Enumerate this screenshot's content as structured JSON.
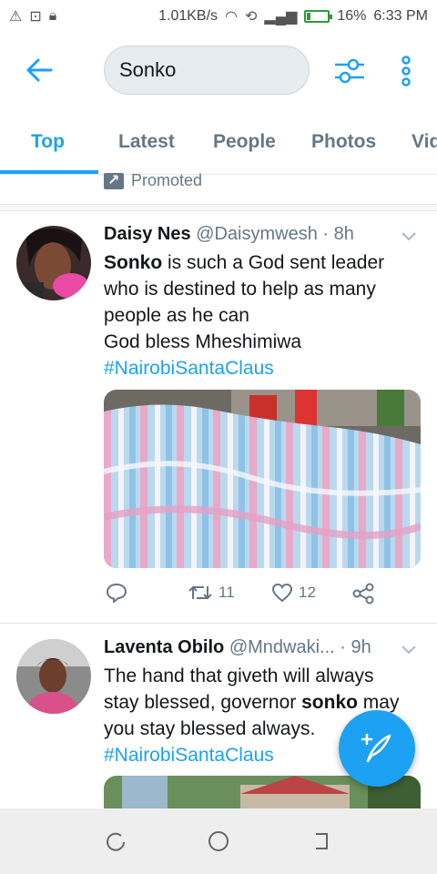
{
  "status_bar": {
    "left_icons": [
      "alert-icon",
      "cast-icon",
      "lock-icon"
    ],
    "speed": "1.01KB/s",
    "battery_percent": "16%",
    "battery_level": 0.16,
    "time": "6:33 PM"
  },
  "search": {
    "value": "Sonko"
  },
  "tabs": [
    {
      "label": "Top"
    },
    {
      "label": "Latest"
    },
    {
      "label": "People"
    },
    {
      "label": "Photos"
    },
    {
      "label": "Vid"
    }
  ],
  "promoted": {
    "label": "Promoted"
  },
  "tweets": [
    {
      "name": "Daisy Nes",
      "handle": "@Daisymwesh",
      "time": "· 8h",
      "bold_word": "Sonko",
      "text_line1": " is such a God sent leader",
      "text_rest": "who is destined to help as many people as he can",
      "text_line4": "God bless Mheshimiwa",
      "hashtag": "#NairobiSantaClaus",
      "retweets": "11",
      "likes": "12"
    },
    {
      "name": "Laventa Obilo",
      "handle": "@Mndwaki...",
      "time": "· 9h",
      "text_part1": "The hand that giveth will always stay blessed, governor ",
      "bold_word": "sonko",
      "text_part2": " may you stay blessed always.",
      "hashtag": "#NairobiSantaClaus"
    }
  ],
  "colors": {
    "accent": "#1da1f2",
    "secondary_text": "#657786",
    "primary_text": "#14171a"
  }
}
